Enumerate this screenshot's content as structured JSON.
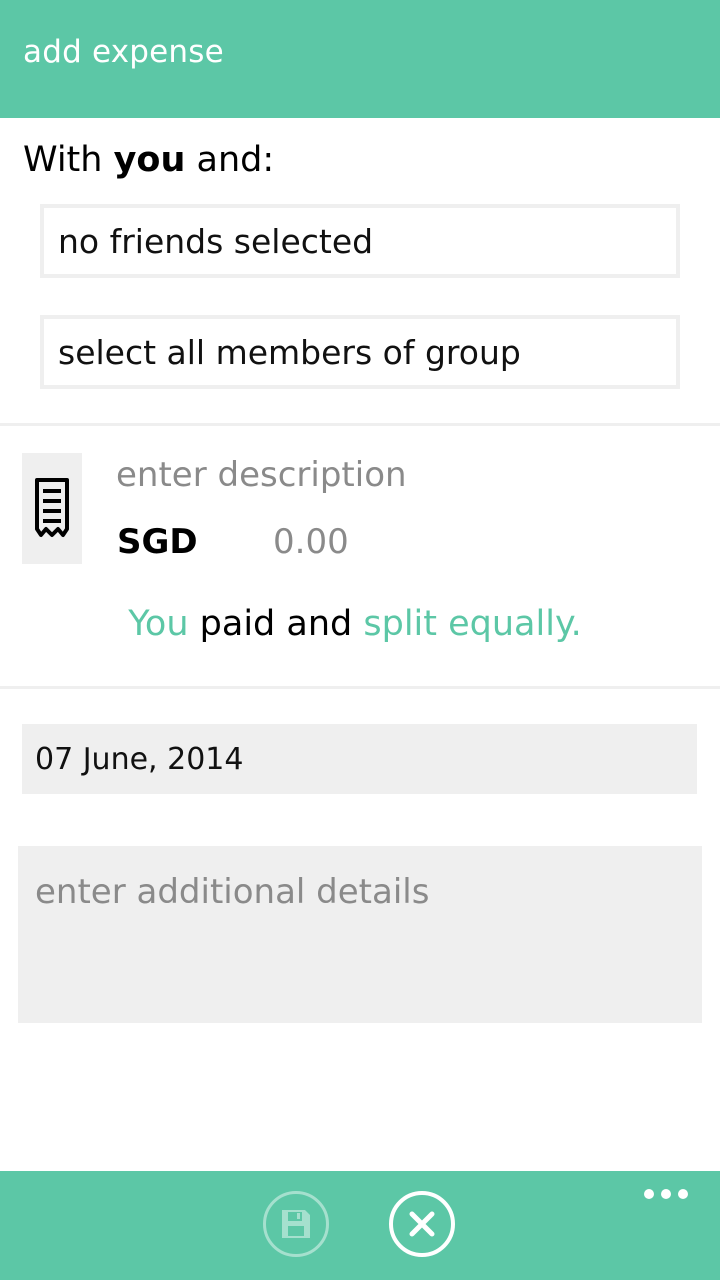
{
  "header": {
    "title": "add expense"
  },
  "participants": {
    "with_prefix": "With",
    "with_you": "you",
    "with_suffix": "and:",
    "friends_button": "no friends selected",
    "group_button": "select all members of group"
  },
  "expense": {
    "icon": "receipt-icon",
    "description_placeholder": "enter description",
    "currency": "SGD",
    "amount_placeholder": "0.00",
    "split_you": "You",
    "split_middle": "paid and",
    "split_mode": "split equally."
  },
  "date": {
    "value": "07 June, 2014"
  },
  "details": {
    "placeholder": "enter additional details"
  },
  "appbar": {
    "save_icon": "save-icon",
    "cancel_icon": "close-icon",
    "more_icon": "more-icon"
  },
  "colors": {
    "accent": "#5cc7a6",
    "field_bg": "#efefef",
    "placeholder": "#8a8a8a"
  }
}
